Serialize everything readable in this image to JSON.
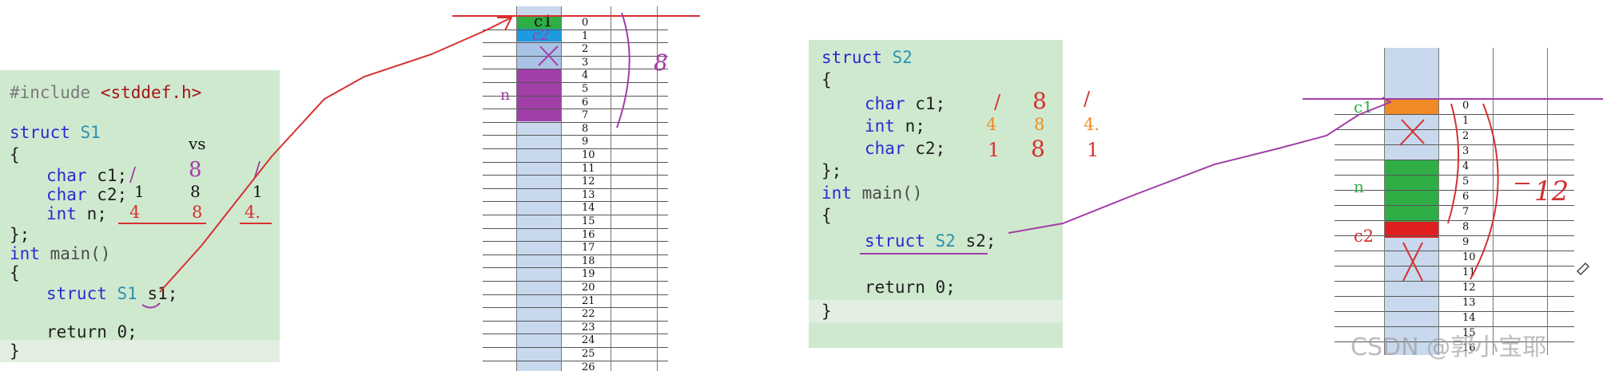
{
  "left_code": {
    "include_kw": "#include",
    "include_file": "<stddef.h>",
    "struct_kw": "struct",
    "struct_name": "S1",
    "open_brace": "{",
    "m1_type": "char",
    "m1_name": "c1;",
    "m2_type": "char",
    "m2_name": "c2;",
    "m3_type": "int",
    "m3_name": "n;",
    "close_struct": "};",
    "main_type": "int",
    "main_fn": "main()",
    "main_open": "{",
    "decl_kw": "struct",
    "decl_type": "S1",
    "decl_var": "s1;",
    "return_stmt": "return 0;",
    "main_close": "}"
  },
  "left_table": {
    "header_vs": "vs",
    "row1": [
      "/",
      "8",
      "/"
    ],
    "row2": [
      "1",
      "8",
      "1"
    ],
    "row3": [
      "4",
      "8",
      "4."
    ]
  },
  "left_memory": {
    "indices": [
      "0",
      "1",
      "2",
      "3",
      "4",
      "5",
      "6",
      "7",
      "8",
      "9",
      "10",
      "11",
      "12",
      "13",
      "14",
      "15",
      "16",
      "17",
      "18",
      "19",
      "20",
      "21",
      "22",
      "23",
      "24",
      "25",
      "26"
    ],
    "label_c1": "c1",
    "label_c2": "c2",
    "label_n": "n",
    "total_note": "8",
    "colors": {
      "c1": "#2fae45",
      "c2": "#1e9be0",
      "n": "#a23ea8",
      "padding": "#a9c3e6",
      "column": "#c8d9ee"
    }
  },
  "right_code": {
    "struct_kw": "struct",
    "struct_name": "S2",
    "open_brace": "{",
    "m1_type": "char",
    "m1_name": "c1;",
    "m2_type": "int",
    "m2_name": "n;",
    "m3_type": "char",
    "m3_name": "c2;",
    "close_struct": "};",
    "main_type": "int",
    "main_fn": "main()",
    "main_open": "{",
    "decl_kw": "struct",
    "decl_type": "S2",
    "decl_var": "s2;",
    "return_stmt": "return 0;",
    "main_close": "}"
  },
  "right_table": {
    "row1": [
      "/",
      "8",
      "/"
    ],
    "row2": [
      "4",
      "8",
      "4."
    ],
    "row3": [
      "1",
      "8",
      "1"
    ]
  },
  "right_memory": {
    "indices": [
      "0",
      "1",
      "2",
      "3",
      "4",
      "5",
      "6",
      "7",
      "8",
      "9",
      "10",
      "11",
      "12",
      "13",
      "14",
      "15",
      "16"
    ],
    "label_c1": "c1",
    "label_n": "n",
    "label_c2": "c2",
    "total_note": "12",
    "colors": {
      "c1": "#f08a24",
      "n": "#2fae45",
      "c2": "#e02020",
      "column": "#c8d9ee"
    }
  },
  "watermark": "CSDN @郭小宝耶"
}
